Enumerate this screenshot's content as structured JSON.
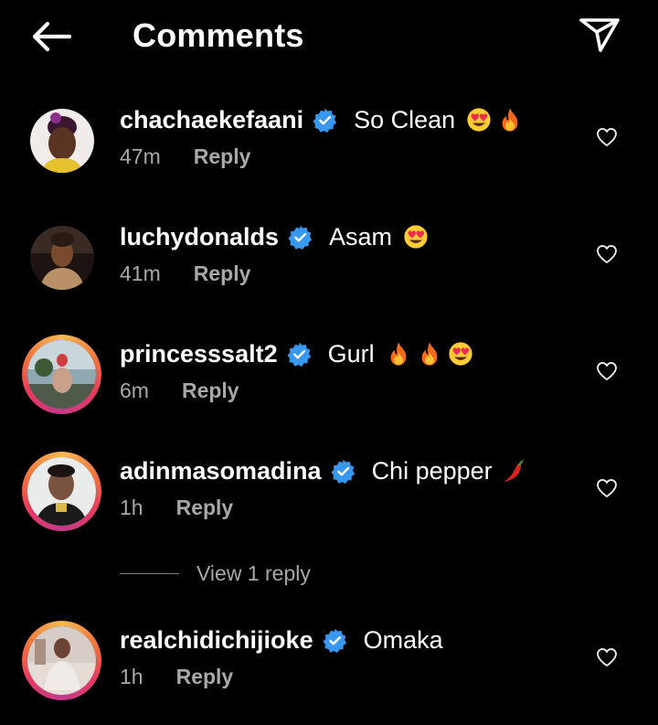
{
  "header": {
    "title": "Comments",
    "back_icon": "arrow-left-icon",
    "share_icon": "send-icon"
  },
  "colors": {
    "verified": "#3897f0",
    "story_ring_start": "#f7b955",
    "story_ring_end": "#c33a8c",
    "muted": "#a8a8a8"
  },
  "comments": [
    {
      "username": "chachaekefaani",
      "text": "So Clean",
      "emojis": [
        "heart-eyes",
        "fire"
      ],
      "time": "47m",
      "reply_label": "Reply",
      "verified": true
    },
    {
      "username": "luchydonalds",
      "text": "Asam",
      "emojis": [
        "heart-eyes"
      ],
      "time": "41m",
      "reply_label": "Reply",
      "verified": true
    },
    {
      "username": "princesssalt2",
      "text": "Gurl",
      "emojis": [
        "fire",
        "fire",
        "heart-eyes"
      ],
      "time": "6m",
      "reply_label": "Reply",
      "verified": true
    },
    {
      "username": "adinmasomadina",
      "text": "Chi pepper",
      "emojis": [
        "chili-pepper"
      ],
      "time": "1h",
      "reply_label": "Reply",
      "verified": true,
      "view_replies_label": "View 1 reply"
    },
    {
      "username": "realchidichijioke",
      "text": "Omaka",
      "emojis": [],
      "time": "1h",
      "reply_label": "Reply",
      "verified": true
    }
  ]
}
